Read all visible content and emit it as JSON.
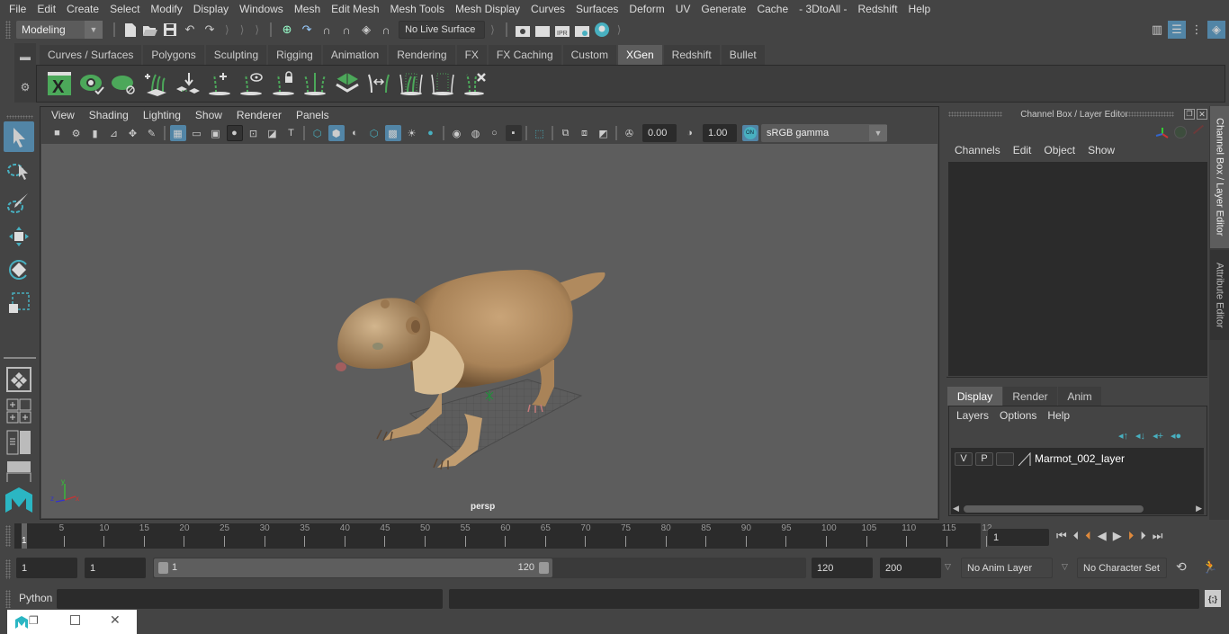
{
  "menubar": {
    "items": [
      "File",
      "Edit",
      "Create",
      "Select",
      "Modify",
      "Display",
      "Windows",
      "Mesh",
      "Edit Mesh",
      "Mesh Tools",
      "Mesh Display",
      "Curves",
      "Surfaces",
      "Deform",
      "UV",
      "Generate",
      "Cache",
      "- 3DtoAll -",
      "Redshift",
      "Help"
    ]
  },
  "statusline": {
    "mode": "Modeling",
    "live_surface": "No Live Surface"
  },
  "shelf": {
    "tabs": [
      "Curves / Surfaces",
      "Polygons",
      "Sculpting",
      "Rigging",
      "Animation",
      "Rendering",
      "FX",
      "FX Caching",
      "Custom",
      "XGen",
      "Redshift",
      "Bullet"
    ],
    "active_tab": "XGen",
    "icons": [
      "xgen-window-icon",
      "xgen-preview-icon",
      "xgen-clear-preview-icon",
      "add-guides-icon",
      "place-guides-icon",
      "add-guide-icon",
      "guide-visibility-icon",
      "lock-guide-icon",
      "guide-split-icon",
      "grid-density-icon",
      "flip-guides-icon",
      "select-guides-icon",
      "guide-cvs-icon",
      "delete-guide-icon"
    ]
  },
  "viewport": {
    "menu": [
      "View",
      "Shading",
      "Lighting",
      "Show",
      "Renderer",
      "Panels"
    ],
    "exposure": "0.00",
    "gamma": "1.00",
    "color_mgmt_badge": "ON",
    "color_space": "sRGB gamma",
    "camera_label": "persp",
    "axis": {
      "x": "x",
      "y": "y",
      "z": "z"
    }
  },
  "channel_box": {
    "title": "Channel Box / Layer Editor",
    "menu": [
      "Channels",
      "Edit",
      "Object",
      "Show"
    ],
    "layer_tabs": [
      "Display",
      "Render",
      "Anim"
    ],
    "active_layer_tab": "Display",
    "layer_menu": [
      "Layers",
      "Options",
      "Help"
    ],
    "layers": [
      {
        "v": "V",
        "p": "P",
        "name": "Marmot_002_layer"
      }
    ]
  },
  "side_tabs": [
    "Channel Box / Layer Editor",
    "Attribute Editor"
  ],
  "timeline": {
    "ticks": [
      "5",
      "10",
      "15",
      "20",
      "25",
      "30",
      "35",
      "40",
      "45",
      "50",
      "55",
      "60",
      "65",
      "70",
      "75",
      "80",
      "85",
      "90",
      "95",
      "100",
      "105",
      "110",
      "115",
      "12"
    ],
    "current_frame_marker": "1",
    "current_frame": "1"
  },
  "range": {
    "start": "1",
    "playback_start": "1",
    "slider_min": "1",
    "slider_max": "120",
    "playback_end": "120",
    "end": "200",
    "anim_layer": "No Anim Layer",
    "character_set": "No Character Set"
  },
  "command": {
    "language": "Python",
    "input": "",
    "output": ""
  },
  "colors": {
    "accent": "#5285a6",
    "xgen_green": "#4ca85a",
    "teal": "#48b0c0",
    "orange": "#e08a3c"
  }
}
